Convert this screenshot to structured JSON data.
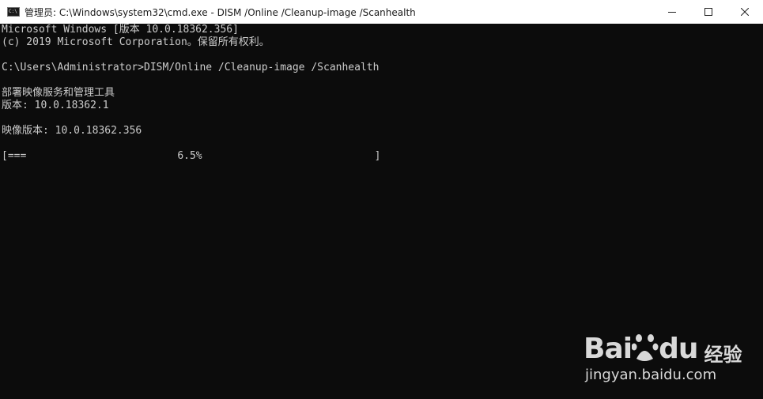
{
  "window": {
    "title": "管理员: C:\\Windows\\system32\\cmd.exe - DISM /Online /Cleanup-image /Scanhealth",
    "icon": "cmd-icon",
    "controls": [
      "minimize-icon",
      "maximize-icon",
      "close-icon"
    ]
  },
  "console": {
    "lines": [
      "Microsoft Windows [版本 10.0.18362.356]",
      "(c) 2019 Microsoft Corporation。保留所有权利。",
      "",
      "C:\\Users\\Administrator>DISM/Online /Cleanup-image /Scanhealth",
      "",
      "部署映像服务和管理工具",
      "版本: 10.0.18362.1",
      "",
      "映像版本: 10.0.18362.356",
      ""
    ],
    "progress": {
      "bar_open": "[",
      "bar_fill": "===",
      "percent_text": "6.5%",
      "bar_close": "]",
      "value": 0.065
    }
  },
  "watermark": {
    "brand_a": "Bai",
    "brand_b": "du",
    "brand_cn": "经验",
    "url": "jingyan.baidu.com"
  },
  "colors": {
    "console_bg": "#0c0c0c",
    "console_fg": "#cccccc",
    "titlebar_bg": "#ffffff",
    "watermark": "#d9d9d9"
  }
}
